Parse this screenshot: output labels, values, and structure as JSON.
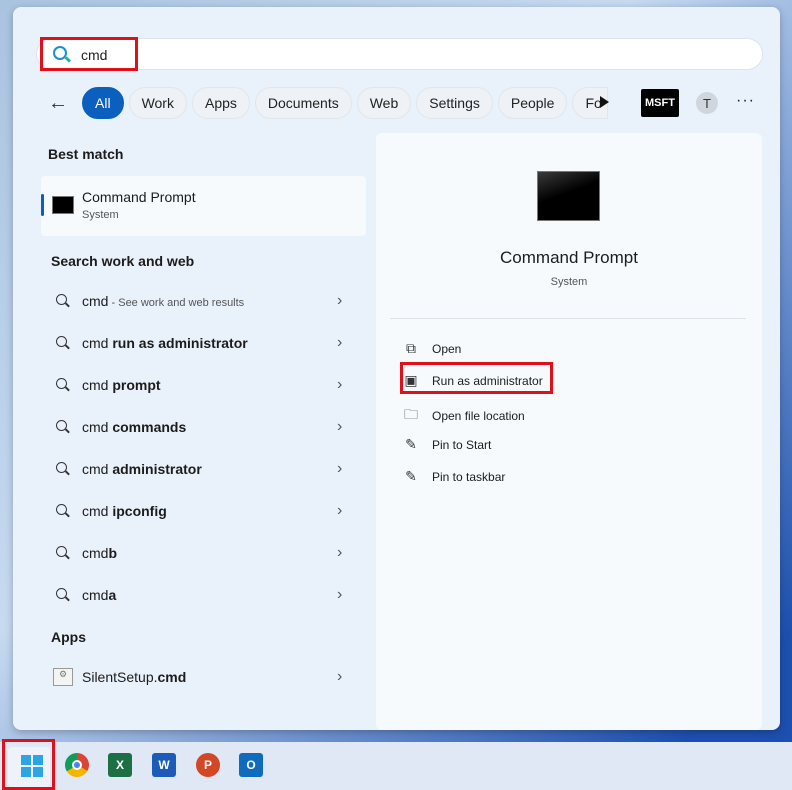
{
  "search": {
    "query": "cmd"
  },
  "filters": {
    "back_icon": "arrow-left-icon",
    "chips": [
      "All",
      "Work",
      "Apps",
      "Documents",
      "Web",
      "Settings",
      "People",
      "Fo"
    ],
    "active": "All",
    "msft": "MSFT",
    "avatar": "T",
    "more": "···"
  },
  "left": {
    "best_match_heading": "Best match",
    "best_match": {
      "title": "Command Prompt",
      "subtitle": "System"
    },
    "web_heading": "Search work and web",
    "web_results": [
      {
        "prefix": "cmd",
        "bold": "",
        "suffix": " - See work and web results"
      },
      {
        "prefix": "cmd ",
        "bold": "run as administrator",
        "suffix": ""
      },
      {
        "prefix": "cmd ",
        "bold": "prompt",
        "suffix": ""
      },
      {
        "prefix": "cmd ",
        "bold": "commands",
        "suffix": ""
      },
      {
        "prefix": "cmd ",
        "bold": "administrator",
        "suffix": ""
      },
      {
        "prefix": "cmd ",
        "bold": "ipconfig",
        "suffix": ""
      },
      {
        "prefix": "cmd",
        "bold": "b",
        "suffix": ""
      },
      {
        "prefix": "cmd",
        "bold": "a",
        "suffix": ""
      }
    ],
    "apps_heading": "Apps",
    "apps": [
      {
        "prefix": "SilentSetup.",
        "bold": "cmd"
      }
    ]
  },
  "right": {
    "title": "Command Prompt",
    "subtitle": "System",
    "actions": [
      {
        "label": "Open",
        "icon": "open-external-icon"
      },
      {
        "label": "Run as administrator",
        "icon": "shield-window-icon"
      },
      {
        "label": "Open file location",
        "icon": "folder-icon"
      },
      {
        "label": "Pin to Start",
        "icon": "pin-icon"
      },
      {
        "label": "Pin to taskbar",
        "icon": "pin-icon"
      }
    ]
  },
  "taskbar": {
    "apps": [
      {
        "name": "Start",
        "icon": "windows-icon"
      },
      {
        "name": "Chrome",
        "icon": "chrome-icon"
      },
      {
        "name": "Excel",
        "letter": "X",
        "color": "#1d7044"
      },
      {
        "name": "Word",
        "letter": "W",
        "color": "#1c5bb8"
      },
      {
        "name": "PowerPoint",
        "letter": "P",
        "color": "#d24726"
      },
      {
        "name": "Outlook",
        "letter": "O",
        "color": "#0f6cbd"
      }
    ]
  }
}
